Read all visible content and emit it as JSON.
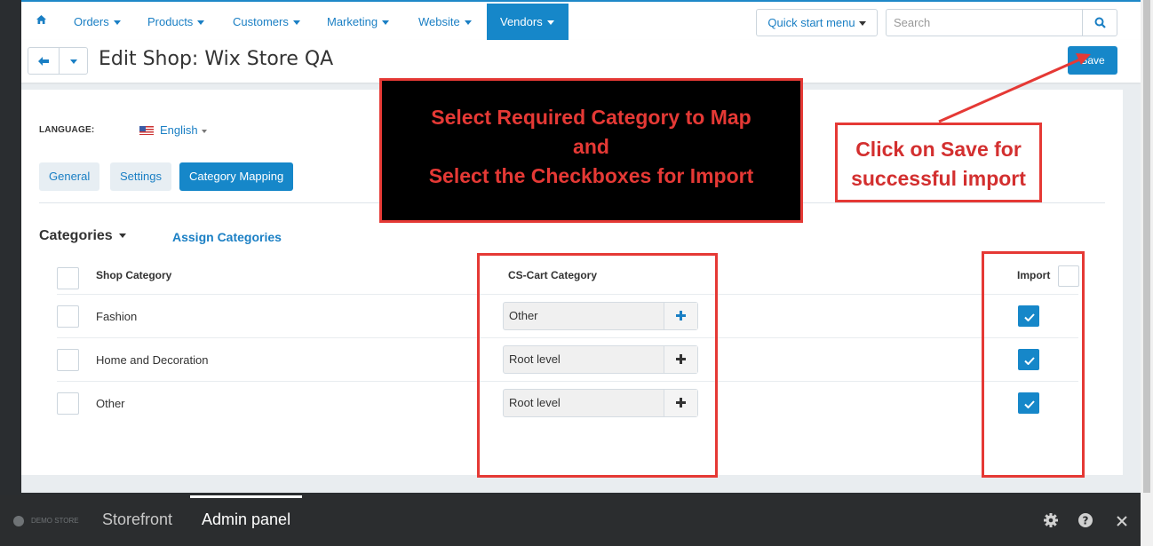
{
  "nav": {
    "items": [
      {
        "label": "Orders"
      },
      {
        "label": "Products"
      },
      {
        "label": "Customers"
      },
      {
        "label": "Marketing"
      },
      {
        "label": "Website"
      },
      {
        "label": "Vendors"
      }
    ],
    "active": "Vendors",
    "quick_start_label": "Quick start menu",
    "search_placeholder": "Search"
  },
  "header": {
    "title": "Edit Shop: Wix Store QA",
    "save_label": "Save"
  },
  "language": {
    "label": "LANGUAGE:",
    "value": "English"
  },
  "tabs": [
    {
      "label": "General"
    },
    {
      "label": "Settings"
    },
    {
      "label": "Category Mapping"
    }
  ],
  "active_tab": "Category Mapping",
  "categories": {
    "heading": "Categories",
    "assign_label": "Assign Categories",
    "columns": {
      "shop": "Shop Category",
      "cscart": "CS-Cart Category",
      "import": "Import"
    },
    "rows": [
      {
        "shop": "Fashion",
        "cscart": "Other",
        "import": true
      },
      {
        "shop": "Home and Decoration",
        "cscart": "Root level",
        "import": true
      },
      {
        "shop": "Other",
        "cscart": "Root level",
        "import": true
      }
    ]
  },
  "annotations": {
    "main_lines": [
      "Select Required Category to Map",
      "and",
      "Select the Checkboxes for Import"
    ],
    "save_lines": [
      "Click on Save for",
      "successful import"
    ]
  },
  "bottom_bar": {
    "demo_label": "DEMO STORE",
    "storefront": "Storefront",
    "admin_panel": "Admin panel"
  },
  "colors": {
    "accent": "#1687c9",
    "annotation_red": "#e53935"
  }
}
